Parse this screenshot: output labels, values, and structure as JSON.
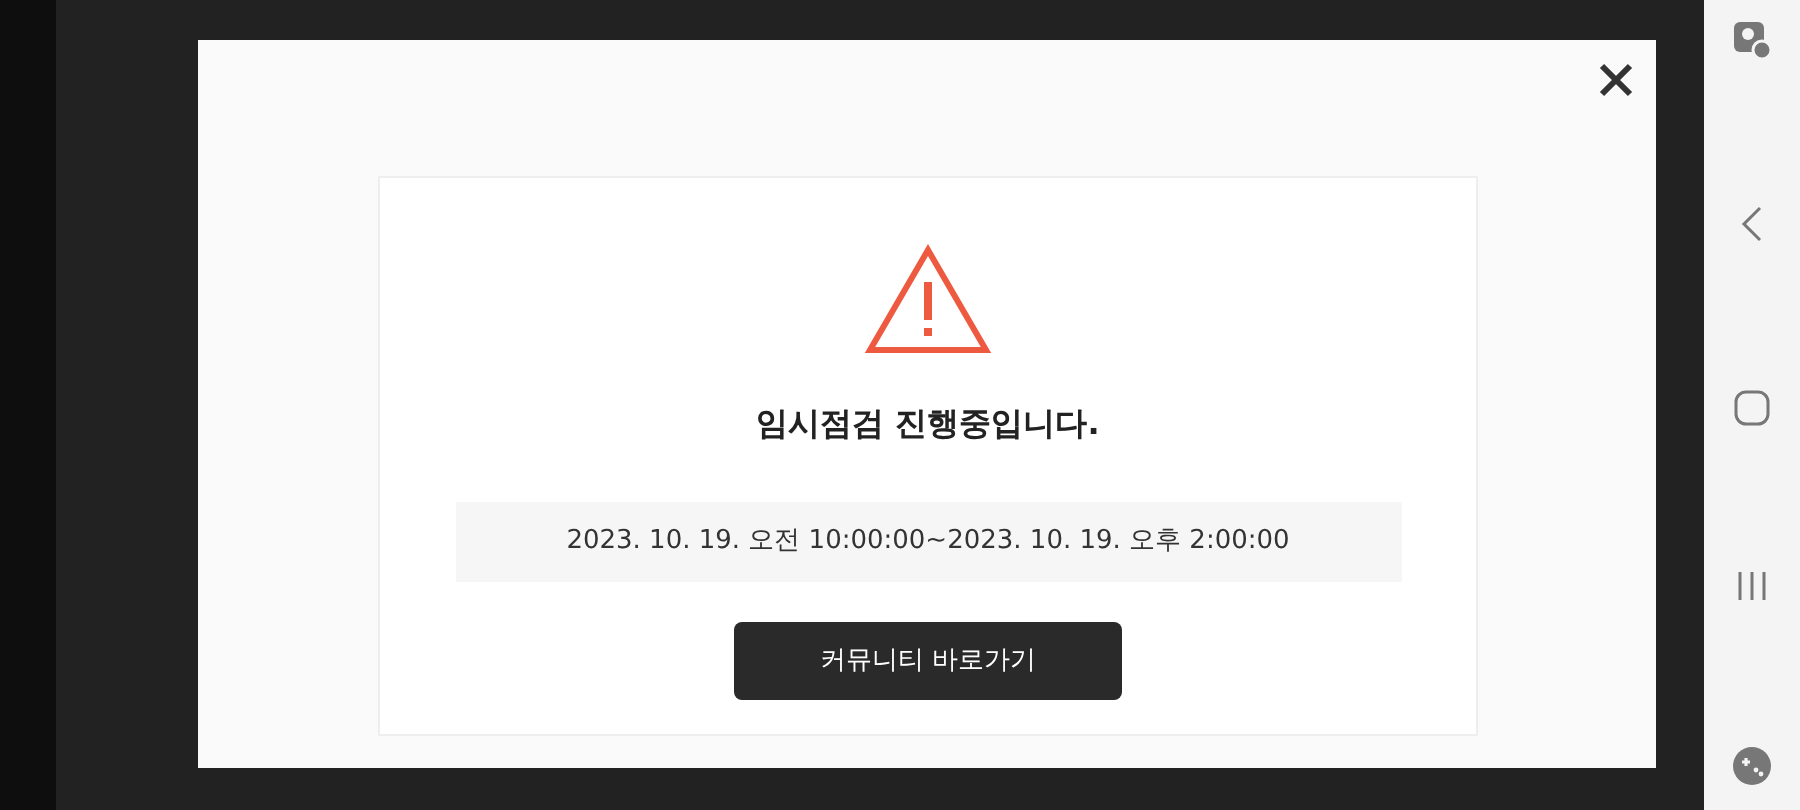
{
  "notice": {
    "title": "임시점검 진행중입니다.",
    "period": "2023. 10. 19. 오전 10:00:00~2023. 10. 19. 오후 2:00:00",
    "button": "커뮤니티 바로가기"
  }
}
